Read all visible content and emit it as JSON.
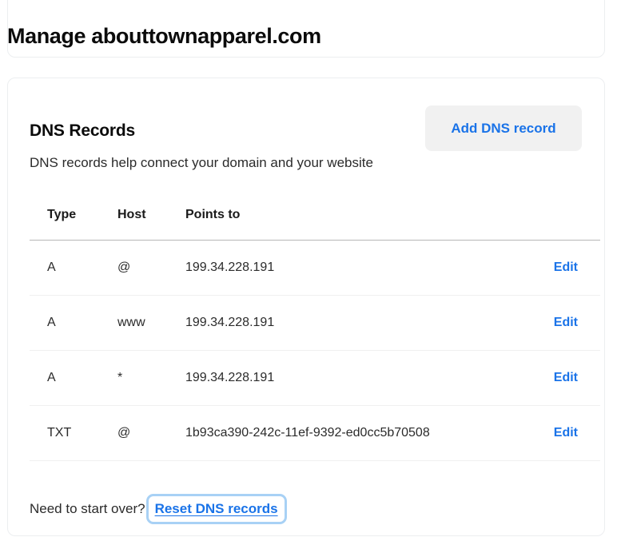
{
  "page": {
    "title": "Manage abouttownapparel.com"
  },
  "dns_card": {
    "heading": "DNS Records",
    "description": "DNS records help connect your domain and your website",
    "add_button_label": "Add DNS record",
    "table": {
      "columns": [
        "Type",
        "Host",
        "Points to",
        ""
      ],
      "rows": [
        {
          "type": "A",
          "host": "@",
          "points_to": "199.34.228.191",
          "action": "Edit"
        },
        {
          "type": "A",
          "host": "www",
          "points_to": "199.34.228.191",
          "action": "Edit"
        },
        {
          "type": "A",
          "host": "*",
          "points_to": "199.34.228.191",
          "action": "Edit"
        },
        {
          "type": "TXT",
          "host": "@",
          "points_to": "1b93ca390-242c-11ef-9392-ed0cc5b70508",
          "action": "Edit"
        }
      ]
    },
    "footer": {
      "prompt": "Need to start over?",
      "reset_link_label": "Reset DNS records"
    }
  },
  "colors": {
    "link_blue": "#1a73e8",
    "button_background": "#f1f1f1",
    "card_border": "#eceef0",
    "header_rule": "#b7b7b7",
    "row_rule": "#f0f0f0",
    "focus_ring": "#a8d1f5"
  }
}
